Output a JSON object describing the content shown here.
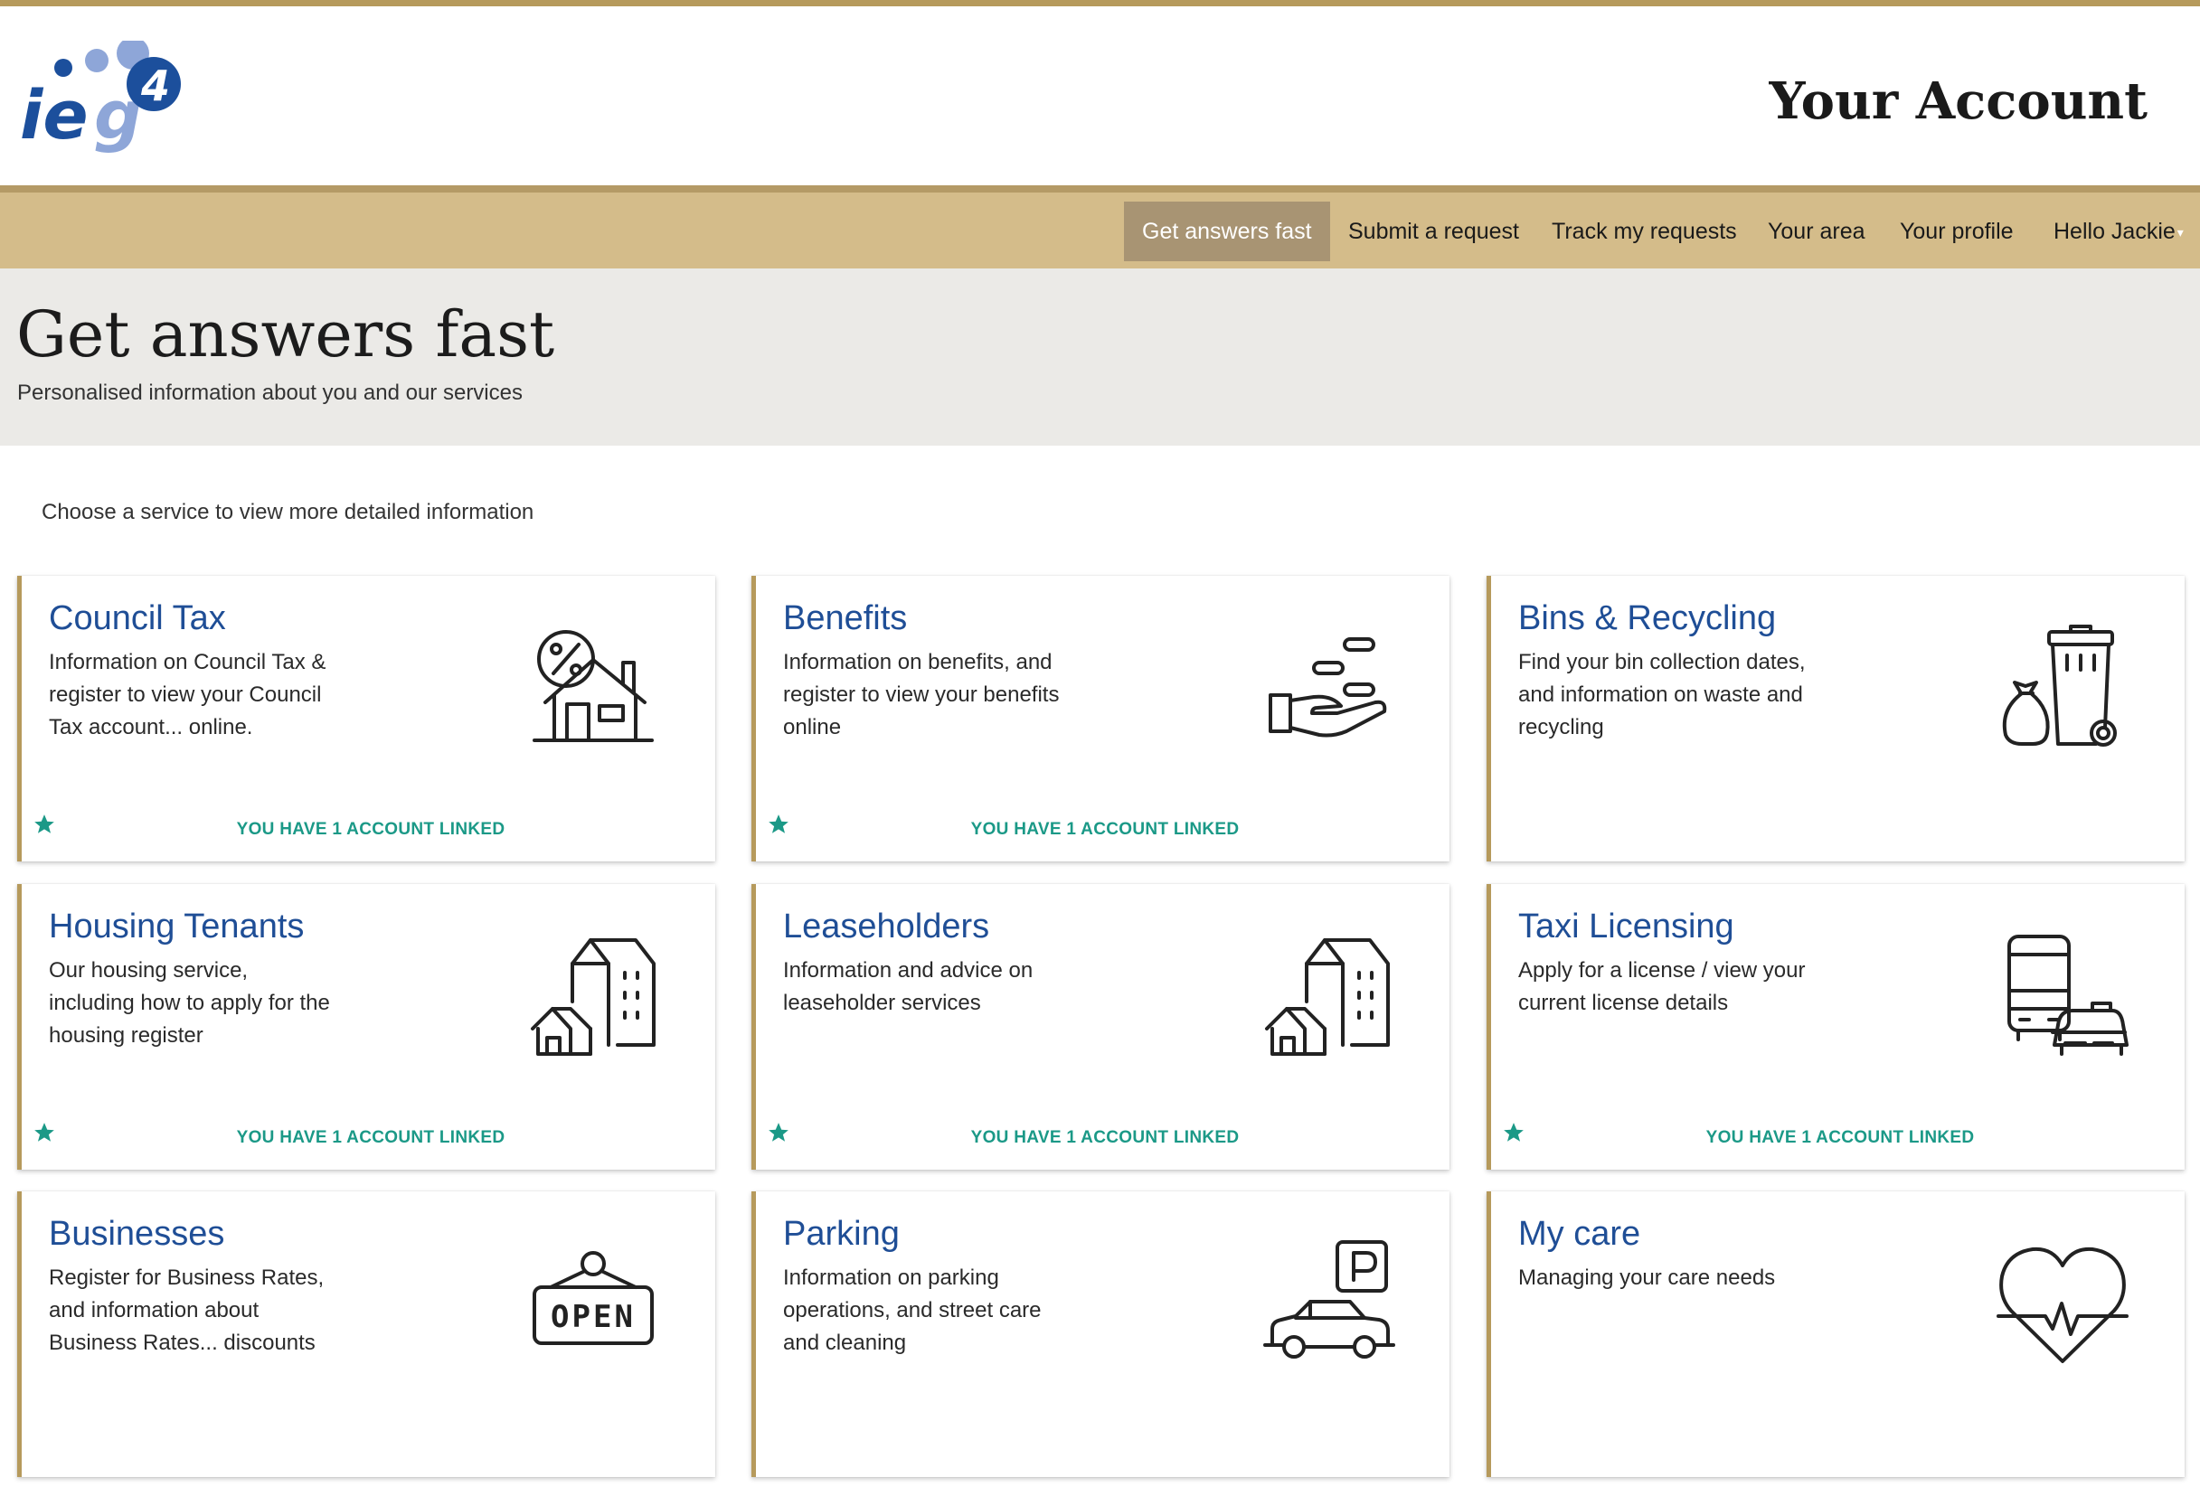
{
  "header": {
    "logo_text": "ieg4",
    "site_title": "Your Account"
  },
  "nav": {
    "items": [
      {
        "label": "Get answers fast",
        "active": true
      },
      {
        "label": "Submit a request"
      },
      {
        "label": "Track my requests"
      },
      {
        "label": "Your area"
      },
      {
        "label": "Your profile"
      },
      {
        "label": "Hello Jackie"
      }
    ]
  },
  "hero": {
    "title": "Get answers fast",
    "subtitle": "Personalised information about you and our services"
  },
  "intro": "Choose a service to view more detailed information",
  "linked_text": "YOU HAVE 1 ACCOUNT LINKED",
  "cards": [
    {
      "title": "Council Tax",
      "desc": "Information on Council Tax & register to view your Council Tax account... online.",
      "icon": "house-percent-icon",
      "linked": true
    },
    {
      "title": "Benefits",
      "desc": "Information on benefits, and register to view your benefits online",
      "icon": "hand-coins-icon",
      "linked": true
    },
    {
      "title": "Bins & Recycling",
      "desc": "Find your bin collection dates, and information on waste and recycling",
      "icon": "wheelie-bin-icon",
      "linked": false
    },
    {
      "title": "Housing Tenants",
      "desc": "Our housing service, including how to apply for the housing register",
      "icon": "buildings-icon",
      "linked": true
    },
    {
      "title": "Leaseholders",
      "desc": "Information and advice on leaseholder services",
      "icon": "buildings-icon",
      "linked": true
    },
    {
      "title": "Taxi Licensing",
      "desc": "Apply for a license / view your current license details",
      "icon": "bus-taxi-icon",
      "linked": true
    },
    {
      "title": "Businesses",
      "desc": "Register for Business Rates, and information about Business Rates... discounts",
      "icon": "open-sign-icon",
      "linked": false
    },
    {
      "title": "Parking",
      "desc": "Information on parking operations, and street care and cleaning",
      "icon": "parking-car-icon",
      "linked": false
    },
    {
      "title": "My care",
      "desc": "Managing your care needs",
      "icon": "heart-pulse-icon",
      "linked": false
    }
  ],
  "colors": {
    "accent_gold": "#b69a5c",
    "nav_bg": "#d4bc8a",
    "nav_active": "#a89473",
    "link_blue": "#1f4e96",
    "teal": "#1b9987",
    "hero_bg": "#ebeae7"
  }
}
